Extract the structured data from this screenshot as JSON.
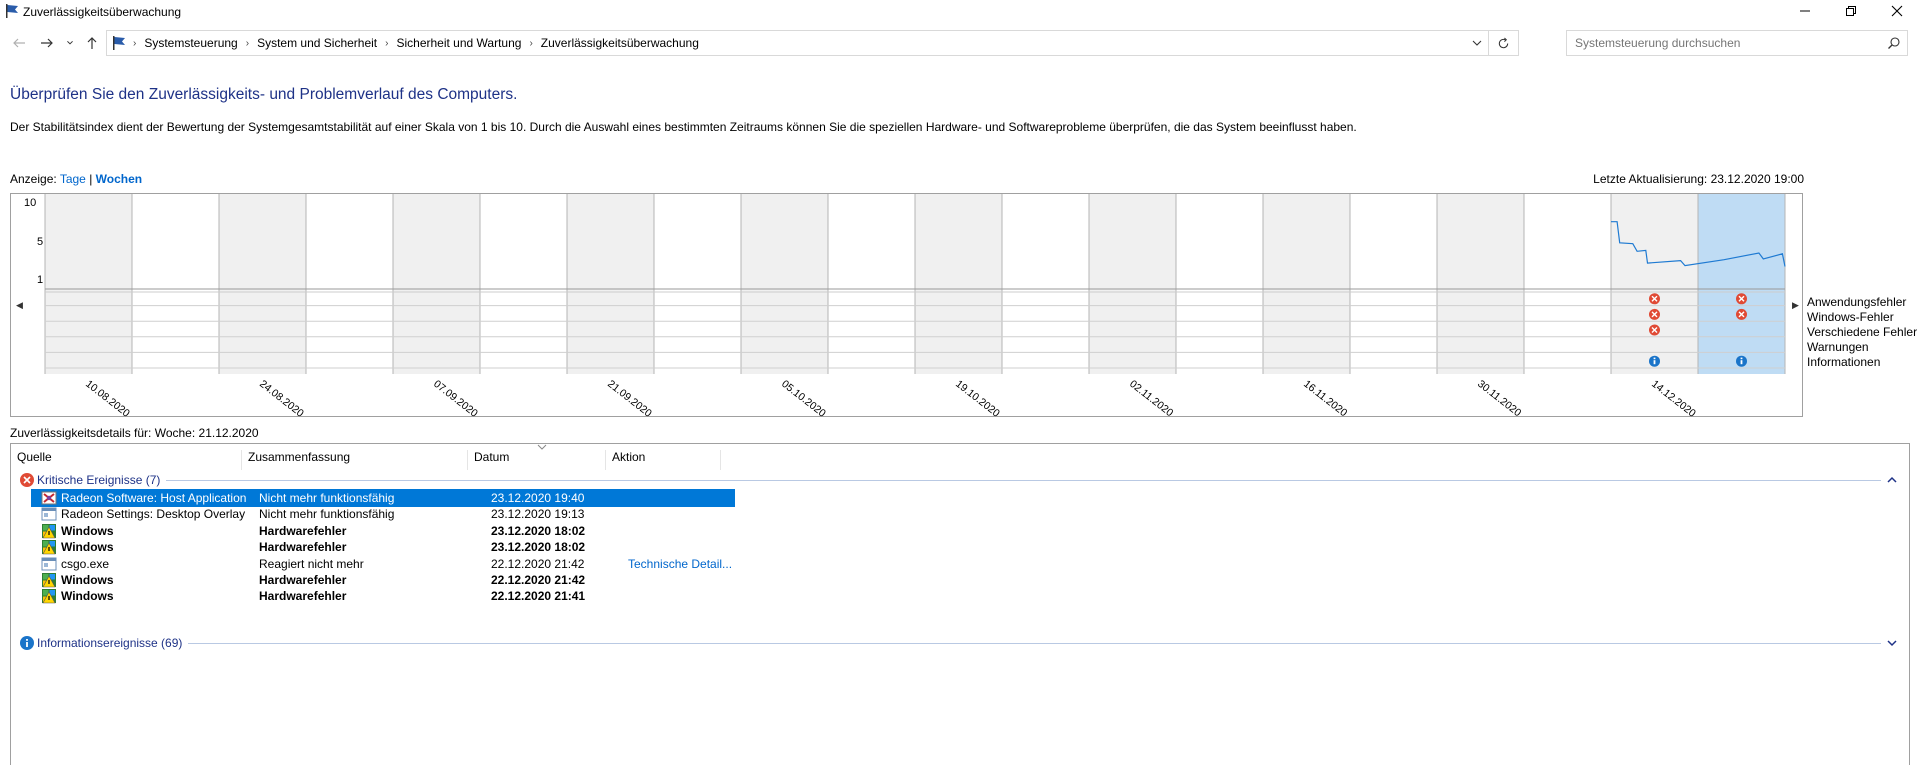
{
  "window": {
    "title": "Zuverlässigkeitsüberwachung",
    "minimize_icon": "minimize-icon",
    "maximize_icon": "restore-icon",
    "close_icon": "close-icon"
  },
  "address": {
    "breadcrumbs": [
      "Systemsteuerung",
      "System und Sicherheit",
      "Sicherheit und Wartung",
      "Zuverlässigkeitsüberwachung"
    ],
    "search_placeholder": "Systemsteuerung durchsuchen"
  },
  "header": {
    "title": "Überprüfen Sie den Zuverlässigkeits- und Problemverlauf des Computers.",
    "description": "Der Stabilitätsindex dient der Bewertung der Systemgesamtstabilität auf einer Skala von 1 bis 10. Durch die Auswahl eines bestimmten Zeitraums können Sie die speziellen Hardware- und Softwareprobleme überprüfen, die das System beeinflusst haben."
  },
  "view": {
    "label": "Anzeige:",
    "days": "Tage",
    "separator": "|",
    "weeks": "Wochen",
    "selected": "Wochen",
    "last_update": "Letzte Aktualisierung: 23.12.2020 19:00"
  },
  "chart_data": {
    "type": "line",
    "y_ticks": [
      "10",
      "5",
      "1"
    ],
    "ylim": [
      1,
      10
    ],
    "x_labels": [
      "10.08.2020",
      "24.08.2020",
      "07.09.2020",
      "21.09.2020",
      "05.10.2020",
      "19.10.2020",
      "02.11.2020",
      "16.11.2020",
      "30.11.2020",
      "14.12.2020"
    ],
    "column_count": 20,
    "selected_column": 19,
    "stability_line": [
      {
        "col": 18.0,
        "v": 7.9
      },
      {
        "col": 18.07,
        "v": 7.9
      },
      {
        "col": 18.1,
        "v": 5.4
      },
      {
        "col": 18.25,
        "v": 5.3
      },
      {
        "col": 18.3,
        "v": 4.4
      },
      {
        "col": 18.4,
        "v": 4.5
      },
      {
        "col": 18.42,
        "v": 3.0
      },
      {
        "col": 18.8,
        "v": 3.3
      },
      {
        "col": 18.85,
        "v": 2.7
      },
      {
        "col": 19.3,
        "v": 3.4
      },
      {
        "col": 19.7,
        "v": 4.2
      },
      {
        "col": 19.75,
        "v": 3.5
      },
      {
        "col": 19.97,
        "v": 4.1
      },
      {
        "col": 20.0,
        "v": 2.6
      }
    ],
    "legend": [
      "Anwendungsfehler",
      "Windows-Fehler",
      "Verschiedene Fehler",
      "Warnungen",
      "Informationen"
    ],
    "event_markers": [
      {
        "col": 18,
        "row": 0,
        "kind": "error"
      },
      {
        "col": 18,
        "row": 1,
        "kind": "error"
      },
      {
        "col": 18,
        "row": 2,
        "kind": "error"
      },
      {
        "col": 18,
        "row": 4,
        "kind": "info"
      },
      {
        "col": 19,
        "row": 0,
        "kind": "error"
      },
      {
        "col": 19,
        "row": 1,
        "kind": "error"
      },
      {
        "col": 19,
        "row": 4,
        "kind": "info"
      }
    ]
  },
  "details": {
    "title": "Zuverlässigkeitsdetails für: Woche: 21.12.2020",
    "columns": [
      "Quelle",
      "Zusammenfassung",
      "Datum",
      "Aktion"
    ],
    "critical_group": "Kritische Ereignisse (7)",
    "info_group": "Informationsereignisse (69)",
    "rows": [
      {
        "source": "Radeon Software: Host Application",
        "summary": "Nicht mehr funktionsfähig",
        "date": "23.12.2020 19:40",
        "action": "",
        "icon": "radeon-app-icon"
      },
      {
        "source": "Radeon Settings: Desktop Overlay",
        "summary": "Nicht mehr funktionsfähig",
        "date": "23.12.2020 19:13",
        "action": "",
        "icon": "app-window-icon"
      },
      {
        "source": "Windows",
        "summary": "Hardwarefehler",
        "date": "23.12.2020 18:02",
        "action": "",
        "icon": "windows-warning-icon"
      },
      {
        "source": "Windows",
        "summary": "Hardwarefehler",
        "date": "23.12.2020 18:02",
        "action": "",
        "icon": "windows-warning-icon"
      },
      {
        "source": "csgo.exe",
        "summary": "Reagiert nicht mehr",
        "date": "22.12.2020 21:42",
        "action": "Technische Detail...",
        "icon": "app-window-icon"
      },
      {
        "source": "Windows",
        "summary": "Hardwarefehler",
        "date": "22.12.2020 21:42",
        "action": "",
        "icon": "windows-warning-icon"
      },
      {
        "source": "Windows",
        "summary": "Hardwarefehler",
        "date": "22.12.2020 21:41",
        "action": "",
        "icon": "windows-warning-icon"
      }
    ]
  },
  "colors": {
    "title_blue": "#1e3287",
    "link_blue": "#0066cc",
    "selection_blue": "#0078d7",
    "selected_column": "#bfdcf4",
    "shaded_column": "#f0f0f0",
    "line_blue": "#1e7ad2",
    "error_red": "#e04a35",
    "info_blue": "#1a74c9"
  }
}
